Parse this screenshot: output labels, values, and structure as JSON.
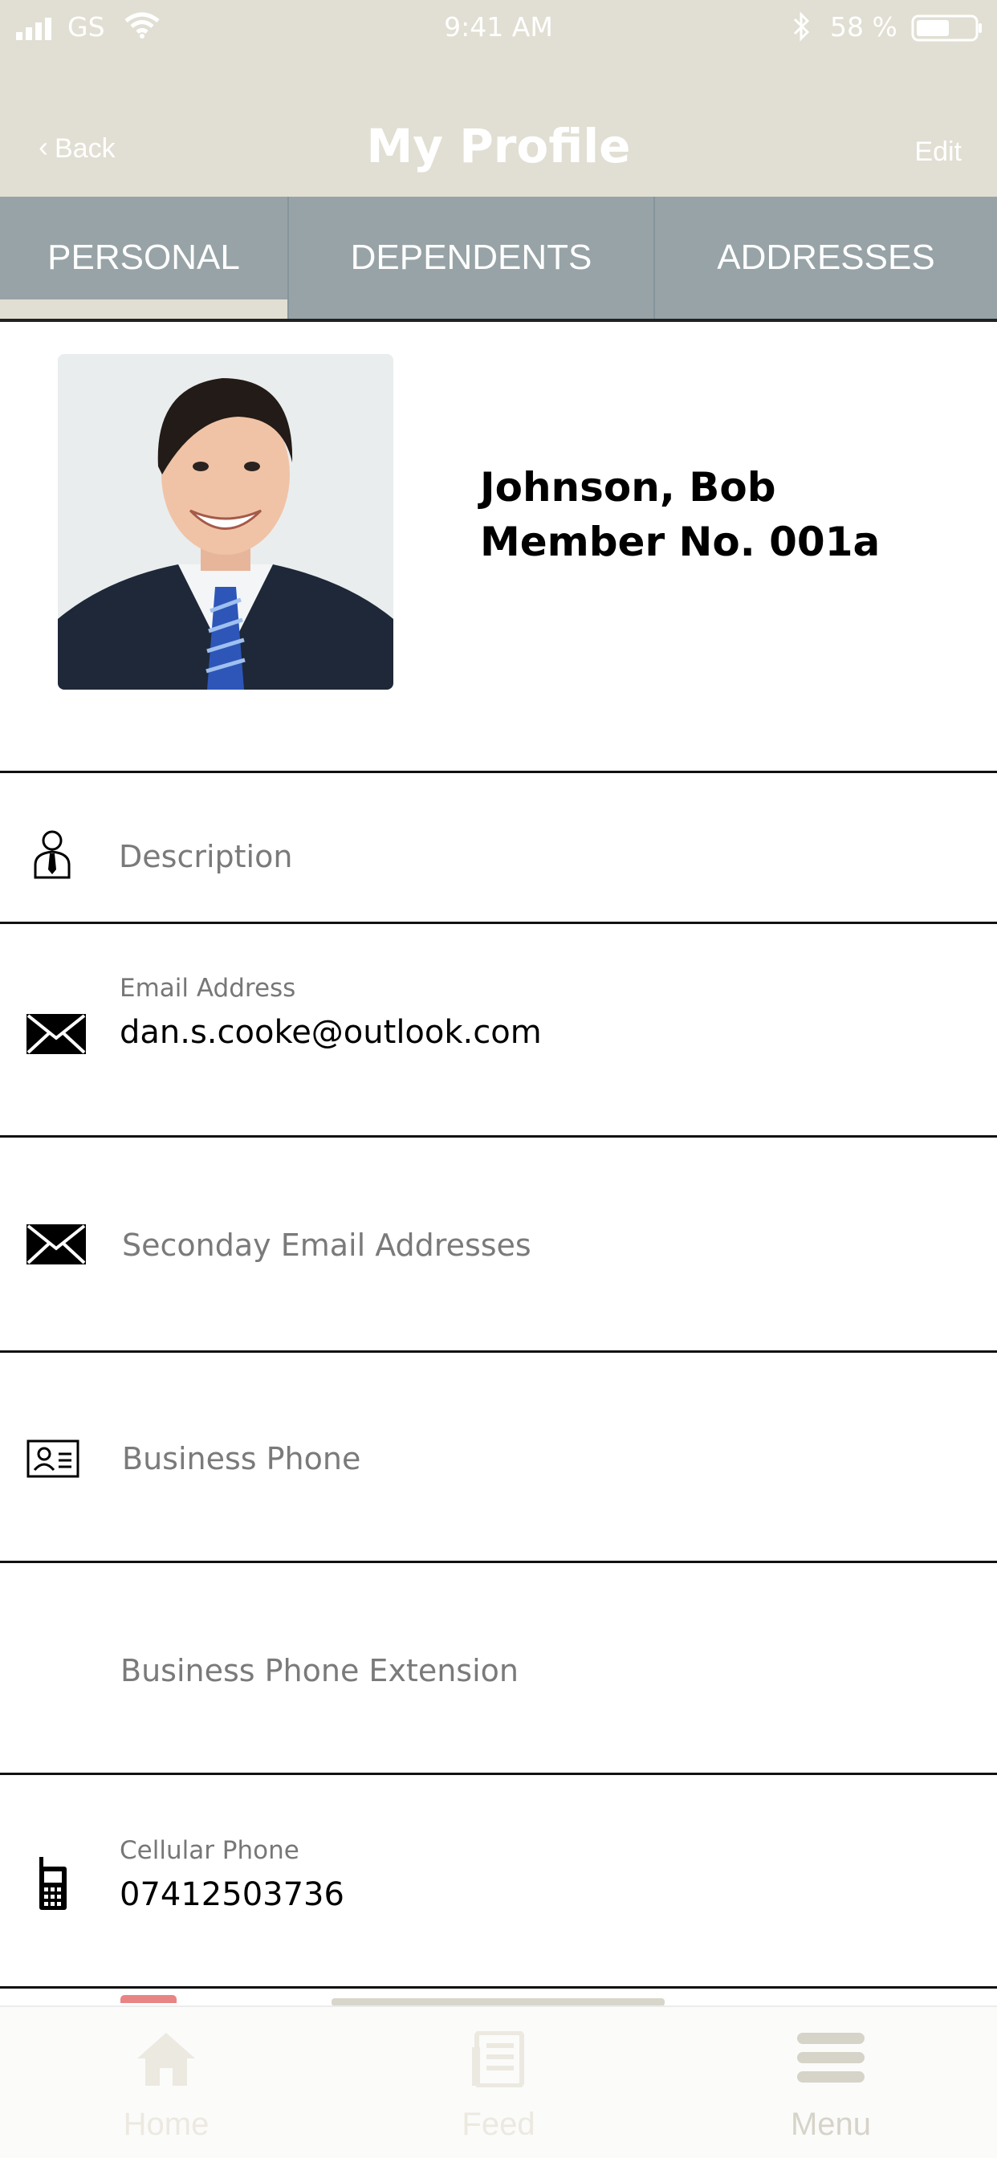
{
  "status_bar": {
    "carrier": "GS",
    "time": "9:41 AM",
    "battery_percent": "58 %"
  },
  "nav": {
    "back_label": "Back",
    "title": "My Profile",
    "edit_label": "Edit"
  },
  "tabs": [
    {
      "label": "PERSONAL",
      "selected": true
    },
    {
      "label": "DEPENDENTS",
      "selected": false
    },
    {
      "label": "ADDRESSES",
      "selected": false
    }
  ],
  "profile": {
    "name": "Johnson, Bob",
    "member_no": "Member No. 001a"
  },
  "fields": {
    "description": {
      "placeholder": "Description",
      "icon": "person-tie-icon"
    },
    "email": {
      "label": "Email Address",
      "value": "dan.s.cooke@outlook.com",
      "icon": "envelope-icon"
    },
    "secondary_email": {
      "placeholder": "Seconday Email Addresses",
      "icon": "envelope-icon"
    },
    "business_phone": {
      "placeholder": "Business Phone",
      "icon": "id-card-icon"
    },
    "business_phone_ext": {
      "placeholder": "Business Phone Extension"
    },
    "cellular_phone": {
      "label": "Cellular Phone",
      "value": "07412503736",
      "icon": "mobile-phone-icon"
    }
  },
  "tabbar": {
    "items": [
      {
        "label": "Home",
        "icon": "home-icon"
      },
      {
        "label": "Feed",
        "icon": "feed-icon"
      },
      {
        "label": "Menu",
        "icon": "menu-icon"
      }
    ]
  },
  "colors": {
    "header_bg": "#e1dfd3",
    "tabs_bg": "#97a3a6",
    "divider": "#111111"
  }
}
